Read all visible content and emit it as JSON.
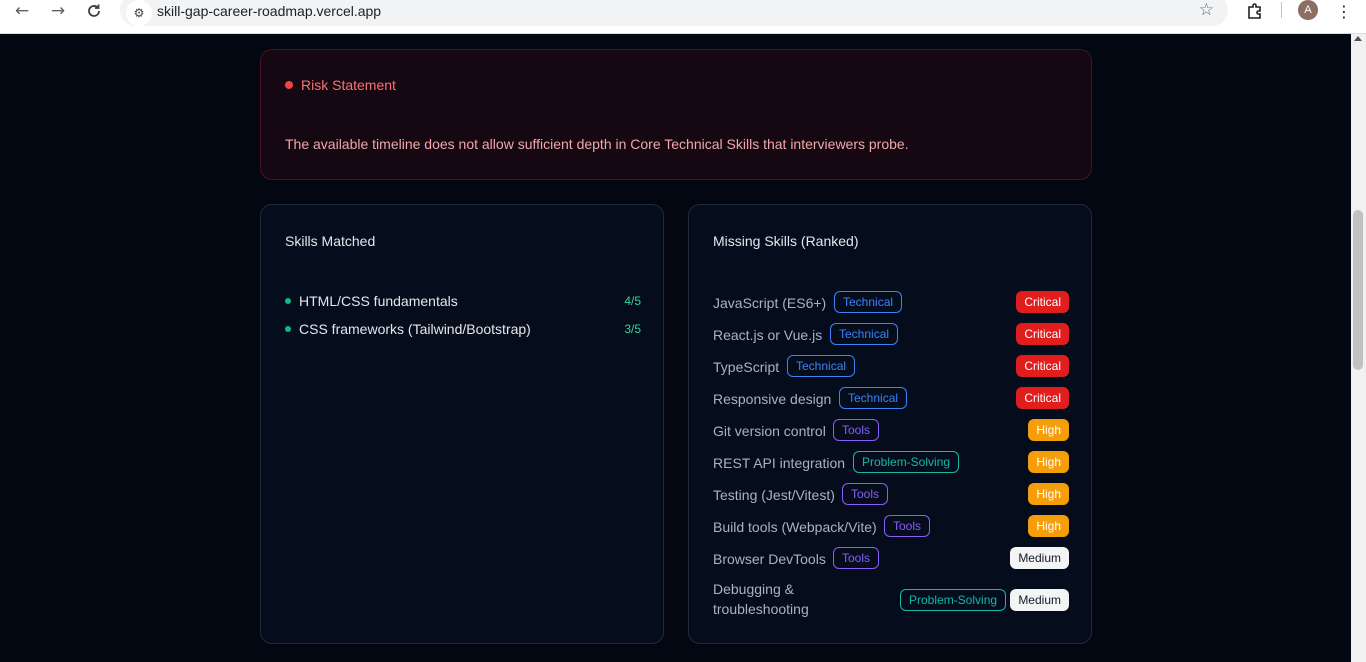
{
  "browser": {
    "url": "skill-gap-career-roadmap.vercel.app",
    "profile_initial": "A"
  },
  "risk": {
    "title": "Risk Statement",
    "text": "The available timeline does not allow sufficient depth in Core Technical Skills that interviewers probe."
  },
  "skills_matched": {
    "title": "Skills Matched",
    "items": [
      {
        "label": "HTML/CSS fundamentals",
        "score": "4/5"
      },
      {
        "label": "CSS frameworks (Tailwind/Bootstrap)",
        "score": "3/5"
      }
    ]
  },
  "missing_skills": {
    "title": "Missing Skills (Ranked)",
    "items": [
      {
        "name": "JavaScript (ES6+)",
        "category": "Technical",
        "severity": "Critical"
      },
      {
        "name": "React.js or Vue.js",
        "category": "Technical",
        "severity": "Critical"
      },
      {
        "name": "TypeScript",
        "category": "Technical",
        "severity": "Critical"
      },
      {
        "name": "Responsive design",
        "category": "Technical",
        "severity": "Critical"
      },
      {
        "name": "Git version control",
        "category": "Tools",
        "severity": "High"
      },
      {
        "name": "REST API integration",
        "category": "Problem-Solving",
        "severity": "High"
      },
      {
        "name": "Testing (Jest/Vitest)",
        "category": "Tools",
        "severity": "High"
      },
      {
        "name": "Build tools (Webpack/Vite)",
        "category": "Tools",
        "severity": "High"
      },
      {
        "name": "Browser DevTools",
        "category": "Tools",
        "severity": "Medium"
      },
      {
        "name": "Debugging & troubleshooting",
        "category": "Problem-Solving",
        "severity": "Medium"
      }
    ]
  },
  "colors": {
    "critical": "#e11d1d",
    "high": "#f59e0b",
    "medium": "#f3f4f6",
    "technical": "#3b82f6",
    "tools": "#8b5cf6",
    "problem_solving": "#14b8a6"
  }
}
